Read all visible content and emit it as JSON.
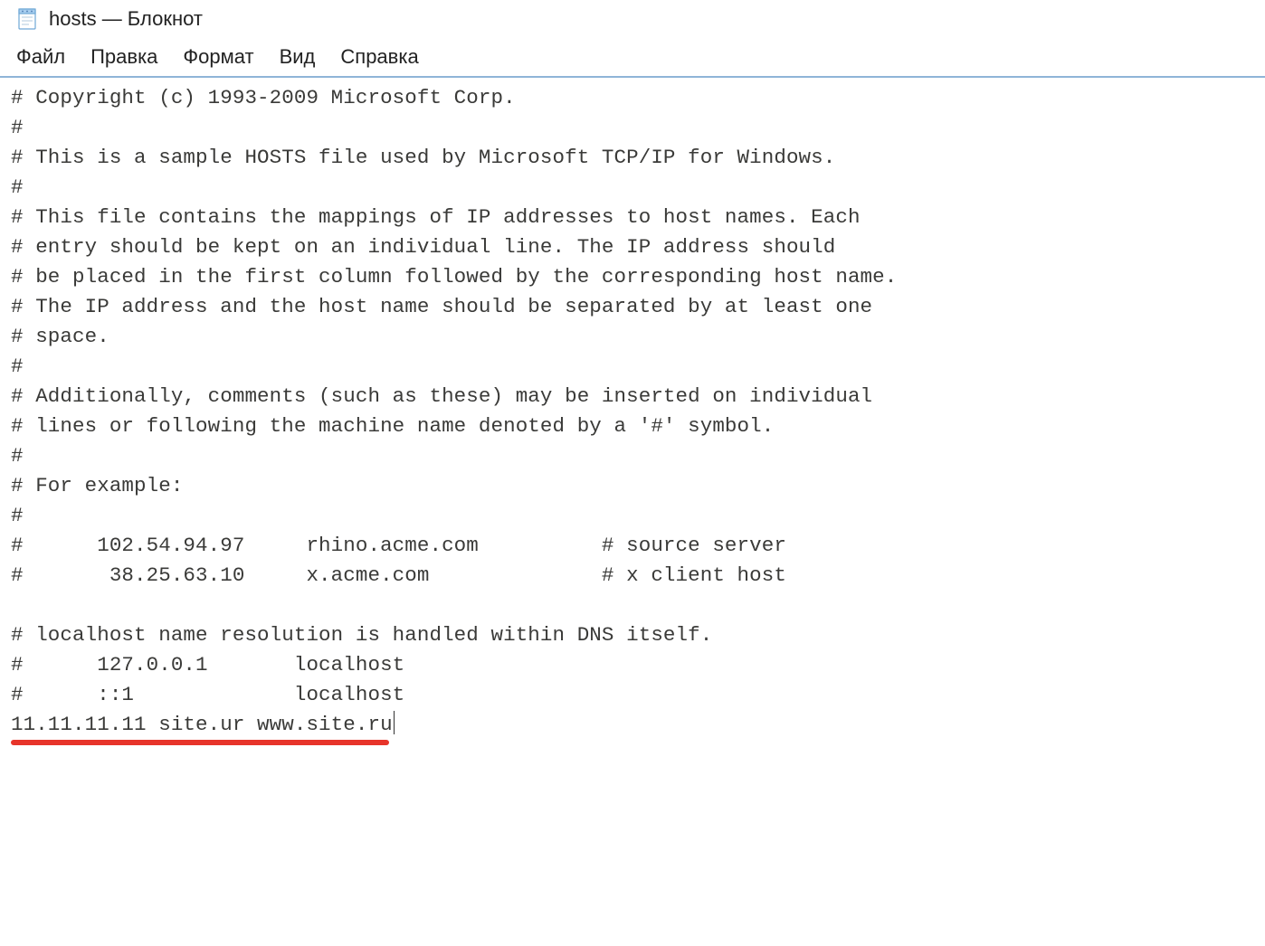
{
  "window": {
    "title": "hosts — Блокнот"
  },
  "menubar": {
    "items": [
      "Файл",
      "Правка",
      "Формат",
      "Вид",
      "Справка"
    ]
  },
  "editor": {
    "content": "# Copyright (c) 1993-2009 Microsoft Corp.\n#\n# This is a sample HOSTS file used by Microsoft TCP/IP for Windows.\n#\n# This file contains the mappings of IP addresses to host names. Each\n# entry should be kept on an individual line. The IP address should\n# be placed in the first column followed by the corresponding host name.\n# The IP address and the host name should be separated by at least one\n# space.\n#\n# Additionally, comments (such as these) may be inserted on individual\n# lines or following the machine name denoted by a '#' symbol.\n#\n# For example:\n#\n#      102.54.94.97     rhino.acme.com          # source server\n#       38.25.63.10     x.acme.com              # x client host\n\n# localhost name resolution is handled within DNS itself.\n#      127.0.0.1       localhost\n#      ::1             localhost\n11.11.11.11 site.ur www.site.ru"
  },
  "annotation": {
    "underline_color": "#e7342a"
  }
}
